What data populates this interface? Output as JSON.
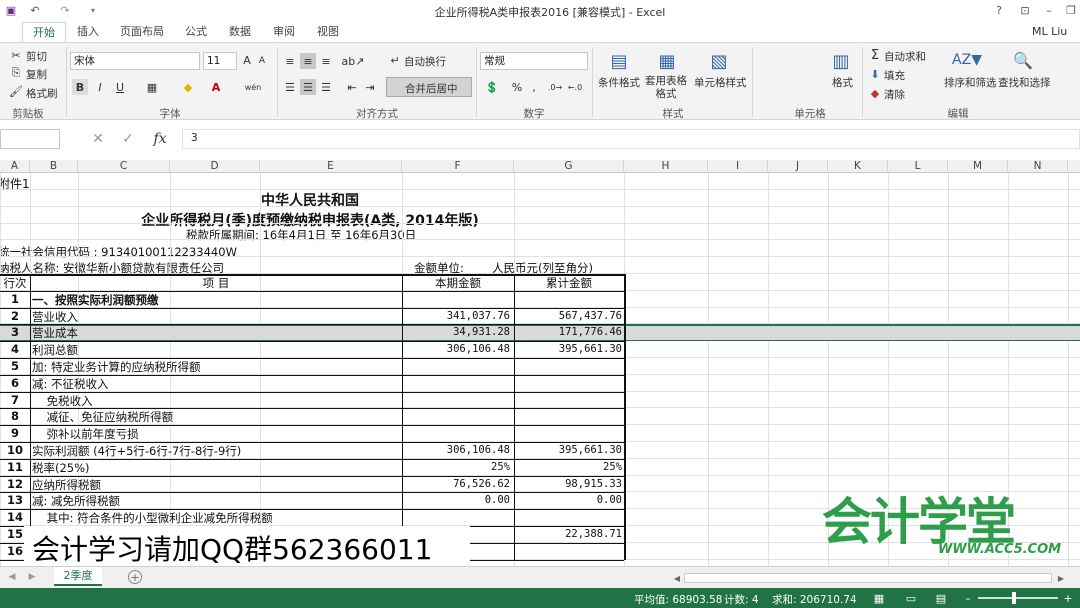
{
  "window": {
    "title": "企业所得税A类申报表2016  [兼容模式] - Excel",
    "user": "ML Liu"
  },
  "ribbon_tabs": [
    "开始",
    "插入",
    "页面布局",
    "公式",
    "数据",
    "审阅",
    "视图"
  ],
  "ribbon": {
    "clipboard": {
      "cut": "剪切",
      "copy": "复制",
      "format_painter": "格式刷",
      "label": "剪贴板"
    },
    "font": {
      "name": "宋体",
      "size": "11",
      "label": "字体",
      "bold": "B",
      "italic": "I",
      "underline": "U"
    },
    "alignment": {
      "wrap": "自动换行",
      "merge": "合并后居中",
      "label": "对齐方式"
    },
    "number": {
      "format": "常规",
      "percent": "%",
      "comma": ",",
      "label": "数字"
    },
    "styles": {
      "conditional": "条件格式",
      "table_format": "套用表格格式",
      "cell_styles": "单元格样式",
      "label": "样式"
    },
    "cells": {
      "format": "格式",
      "label": "单元格"
    },
    "editing": {
      "autosum": "自动求和",
      "fill": "填充",
      "clear": "清除",
      "sort_filter": "排序和筛选",
      "find_select": "查找和选择",
      "label": "编辑"
    }
  },
  "formula_bar": {
    "name_box": "",
    "fx": "fx",
    "value": "3"
  },
  "columns": [
    "A",
    "B",
    "C",
    "D",
    "E",
    "F",
    "G",
    "H",
    "I",
    "J",
    "K",
    "L",
    "M",
    "N"
  ],
  "sheet": {
    "attachment": "附件1",
    "title1": "中华人民共和国",
    "title2": "企业所得税月(季)度预缴纳税申报表(A类, 2014年版)",
    "period": "税款所属期间: 16年4月1日  至  16年6月30日",
    "credit_code": "统一社会信用代码  : 91340100112233440W",
    "taxpayer": "纳税人名称: 安徽华新小额贷款有限责任公司",
    "unit_label": "金额单位:",
    "unit_value": "人民币元(列至角分)",
    "header": {
      "row": "行次",
      "item": "项          目",
      "current": "本期金额",
      "cumulative": "累计金额"
    },
    "rows": [
      {
        "no": "1",
        "item": "一、按照实际利润额预缴",
        "current": "",
        "cumulative": "",
        "bold": true
      },
      {
        "no": "2",
        "item": "营业收入",
        "current": "341,037.76",
        "cumulative": "567,437.76"
      },
      {
        "no": "3",
        "item": "营业成本",
        "current": "34,931.28",
        "cumulative": "171,776.46"
      },
      {
        "no": "4",
        "item": "利润总额",
        "current": "306,106.48",
        "cumulative": "395,661.30"
      },
      {
        "no": "5",
        "item": "加: 特定业务计算的应纳税所得额",
        "current": "",
        "cumulative": ""
      },
      {
        "no": "6",
        "item": "减: 不征税收入",
        "current": "",
        "cumulative": ""
      },
      {
        "no": "7",
        "item": "    免税收入",
        "current": "",
        "cumulative": ""
      },
      {
        "no": "8",
        "item": "    减征、免征应纳税所得额",
        "current": "",
        "cumulative": ""
      },
      {
        "no": "9",
        "item": "    弥补以前年度亏损",
        "current": "",
        "cumulative": ""
      },
      {
        "no": "10",
        "item": "实际利润额 (4行+5行-6行-7行-8行-9行)",
        "current": "306,106.48",
        "cumulative": "395,661.30"
      },
      {
        "no": "11",
        "item": "税率(25%)",
        "current": "25%",
        "cumulative": "25%"
      },
      {
        "no": "12",
        "item": "应纳所得税额",
        "current": "76,526.62",
        "cumulative": "98,915.33"
      },
      {
        "no": "13",
        "item": "减: 减免所得税额",
        "current": "0.00",
        "cumulative": "0.00"
      },
      {
        "no": "14",
        "item": "    其中: 符合条件的小型微利企业减免所得税额",
        "current": "",
        "cumulative": ""
      },
      {
        "no": "15",
        "item": "",
        "current": "",
        "cumulative": "22,388.71"
      },
      {
        "no": "16",
        "item": "",
        "current": "",
        "cumulative": ""
      }
    ]
  },
  "overlay": {
    "qq_text": "会计学习请加QQ群562366011",
    "logo_text": "会计学堂",
    "logo_url": "WWW.ACC5.COM"
  },
  "sheet_tab": "2季度",
  "status": {
    "average": "平均值: 68903.58",
    "count": "计数: 4",
    "sum": "求和: 206710.74"
  }
}
